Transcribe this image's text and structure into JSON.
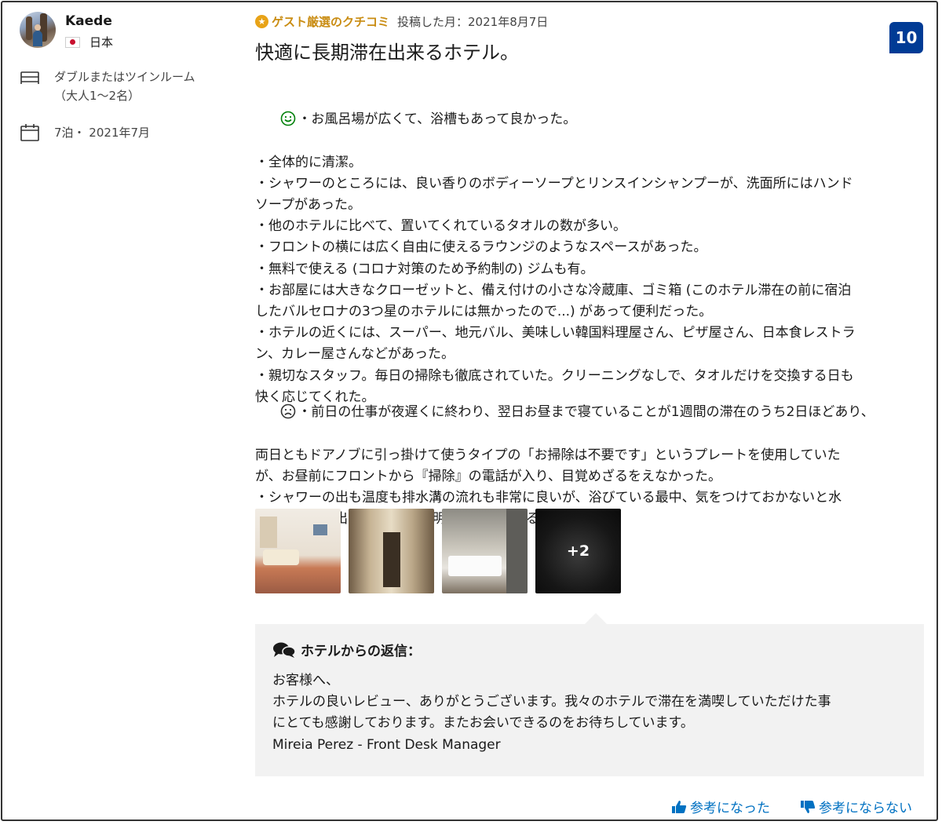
{
  "reviewer": {
    "name": "Kaede",
    "country": "日本",
    "room": "ダブルまたはツインルーム\n（大人1〜2名）",
    "stay": "7泊・ 2021年7月"
  },
  "review": {
    "badge": "ゲスト厳選のクチコミ",
    "posted": "投稿した月：2021年8月7日",
    "score": "10",
    "title": "快適に長期滞在出来るホテル。",
    "positive_lines": [
      "・お風呂場が広くて、浴槽もあって良かった。",
      "・全体的に清潔。",
      "・シャワーのところには、良い香りのボディーソープとリンスインシャンプーが、洗面所にはハンド",
      "ソープがあった。",
      "・他のホテルに比べて、置いてくれているタオルの数が多い。",
      "・フロントの横には広く自由に使えるラウンジのようなスペースがあった。",
      "・無料で使える (コロナ対策のため予約制の) ジムも有。",
      "・お部屋には大きなクローゼットと、備え付けの小さな冷蔵庫、ゴミ箱 (このホテル滞在の前に宿泊",
      "したバルセロナの3つ星のホテルには無かったので...) があって便利だった。",
      "・ホテルの近くには、スーパー、地元バル、美味しい韓国料理屋さん、ピザ屋さん、日本食レストラ",
      "ン、カレー屋さんなどがあった。",
      "・親切なスタッフ。毎日の掃除も徹底されていた。クリーニングなしで、タオルだけを交換する日も",
      "快く応じてくれた。"
    ],
    "negative_lines": [
      "・前日の仕事が夜遅くに終わり、翌日お昼まで寝ていることが1週間の滞在のうち2日ほどあり、",
      "両日ともドアノブに引っ掛けて使うタイプの「お掃除は不要です」というプレートを使用していた",
      "が、お昼前にフロントから『掃除』の電話が入り、目覚めざるをえなかった。",
      "・シャワーの出も温度も排水溝の流れも非常に良いが、浴びている最中、気をつけておかないと水",
      "が外に散って出てしまう。(透明のボードがあるものの...。)"
    ],
    "more_photos": "+2"
  },
  "reply": {
    "heading": "ホテルからの返信：",
    "lines": [
      "お客様へ、",
      "ホテルの良いレビュー、ありがとうございます。我々のホテルで滞在を満喫していただけた事",
      "にとても感謝しております。またお会いできるのをお待ちしています。",
      "Mireia Perez - Front Desk Manager"
    ]
  },
  "actions": {
    "helpful": "参考になった",
    "not_helpful": "参考にならない"
  },
  "colors": {
    "badge": "#c98c12",
    "score_bg": "#003b95",
    "link": "#0071c2",
    "positive_face": "#008009",
    "reply_bg": "#f2f2f2"
  }
}
